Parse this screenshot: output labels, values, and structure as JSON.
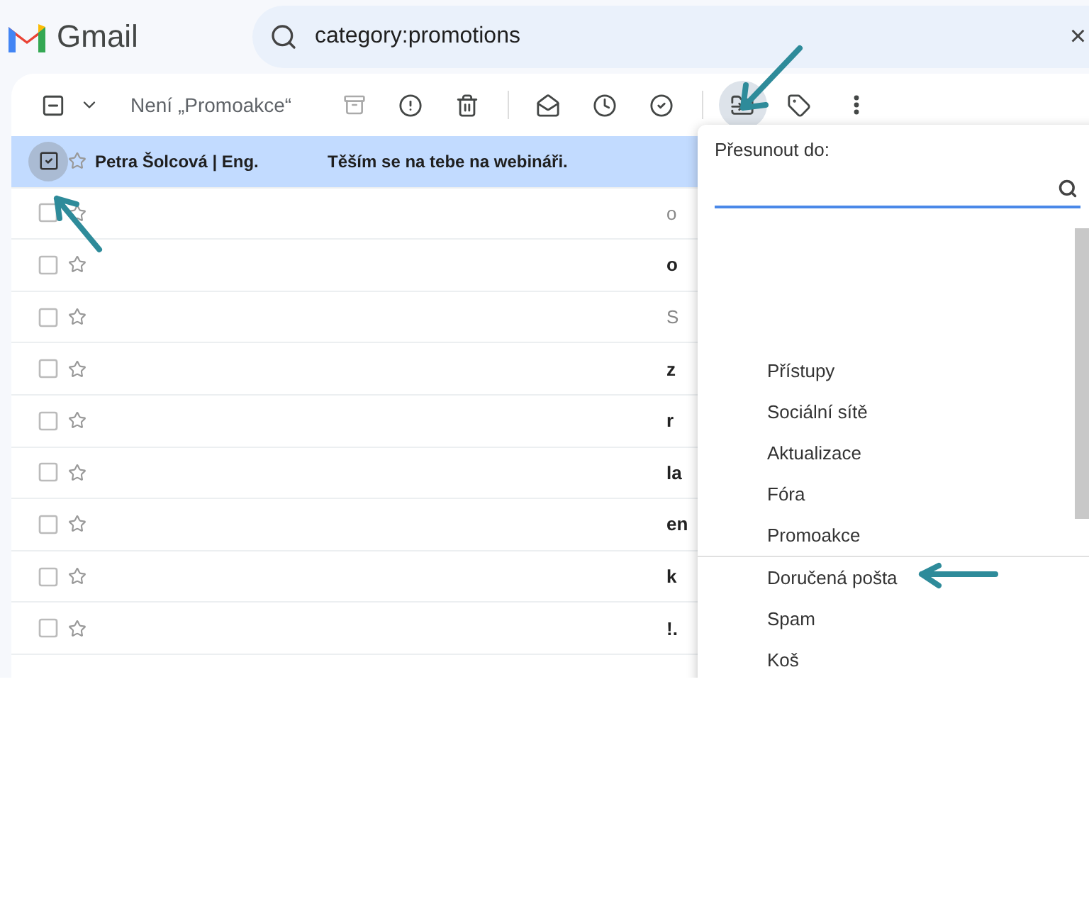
{
  "header": {
    "app_name": "Gmail",
    "search": {
      "value": "category:promotions"
    },
    "clear": "×"
  },
  "toolbar": {
    "filter_label": "Není „Promoakce“",
    "move_open": true,
    "select_indeterminate": true
  },
  "rows": [
    {
      "sender": "Petra Šolcová | Eng.",
      "subject": "Těším se na tebe na webináři.",
      "selected": true,
      "checked": true
    },
    {
      "fragment": "o",
      "unread": false,
      "selected": false,
      "checked": false
    },
    {
      "fragment": "o",
      "unread": true,
      "selected": false,
      "checked": false
    },
    {
      "fragment": "S",
      "unread": false,
      "selected": false,
      "checked": false
    },
    {
      "fragment": "z",
      "unread": true,
      "selected": false,
      "checked": false
    },
    {
      "fragment": "r",
      "unread": true,
      "selected": false,
      "checked": false
    },
    {
      "fragment": "la",
      "unread": true,
      "selected": false,
      "checked": false
    },
    {
      "fragment": "en",
      "unread": true,
      "selected": false,
      "checked": false
    },
    {
      "fragment": "k",
      "unread": true,
      "selected": false,
      "checked": false
    },
    {
      "fragment": "!.",
      "unread": true,
      "selected": false,
      "checked": false
    }
  ],
  "move_menu": {
    "title": "Přesunout do:",
    "labels": [
      "Přístupy",
      "Sociální sítě",
      "Aktualizace",
      "Fóra",
      "Promoakce"
    ],
    "fixed": [
      "Doručená pošta",
      "Spam",
      "Koš"
    ]
  }
}
